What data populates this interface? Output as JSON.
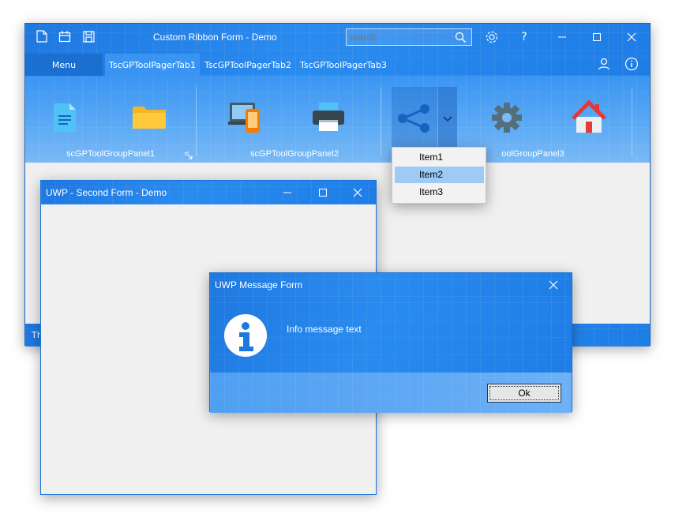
{
  "main_window": {
    "title": "Custom Ribbon Form - Demo",
    "search_placeholder": "search",
    "tabs": [
      {
        "label": "Menu"
      },
      {
        "label": "TscGPToolPagerTab1"
      },
      {
        "label": "TscGPToolPagerTab2"
      },
      {
        "label": "TscGPToolPagerTab3"
      }
    ],
    "groups": [
      {
        "label": "scGPToolGroupPanel1"
      },
      {
        "label": "scGPToolGroupPanel2"
      },
      {
        "label": "oolGroupPanel3"
      }
    ],
    "status_text": "Th",
    "help_glyph": "?"
  },
  "dropdown": {
    "items": [
      "Item1",
      "Item2",
      "Item3"
    ],
    "selected": "Item2"
  },
  "second_form": {
    "title": "UWP - Second Form - Demo"
  },
  "message_form": {
    "title": "UWP Message Form",
    "message": "Info message text",
    "ok_label": "Ok"
  },
  "colors": {
    "accent": "#1e78e0",
    "selection": "#9dcbf5",
    "folder": "#f5b623",
    "home_roof": "#e53935"
  }
}
